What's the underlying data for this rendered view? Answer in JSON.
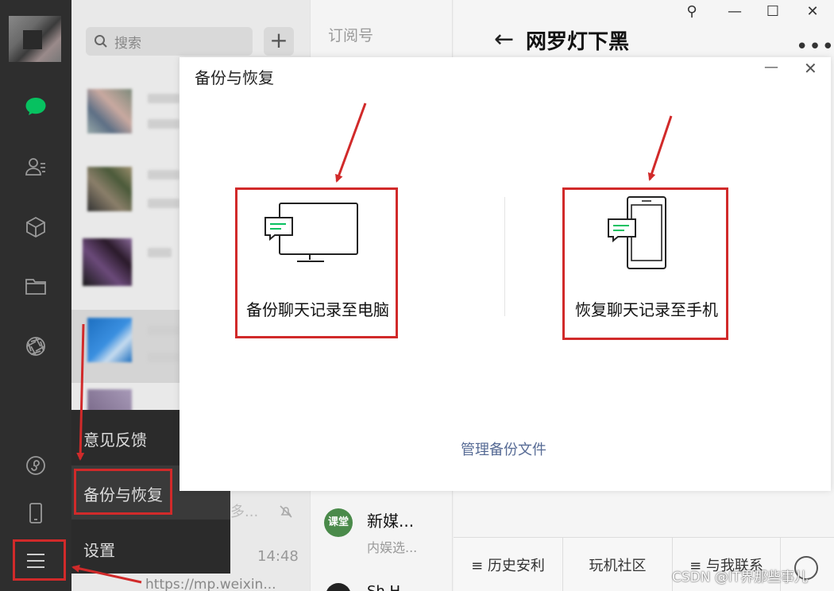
{
  "sidebar": {
    "icons": [
      "chat-icon",
      "contacts-icon",
      "favorites-icon",
      "files-icon",
      "moments-icon",
      "mini-program-icon",
      "phone-icon",
      "menu-icon"
    ]
  },
  "chat_list": {
    "search_placeholder": "搜索",
    "add_symbol": "+",
    "visible_time": "14:48",
    "fragment": "多...",
    "url_preview": "https://mp.weixin..."
  },
  "subscriptions": {
    "title": "订阅号",
    "account_logo_text": "课堂",
    "account_name": "新媒...",
    "account_desc": "内娱选...",
    "account2_name": "Sh H..."
  },
  "article": {
    "title": "网罗灯下黑",
    "back_symbol": "←",
    "more_symbol": "•••",
    "window_buttons": [
      "⚲",
      "—",
      "☐",
      "✕"
    ],
    "bottom_menu": [
      "≡ 历史安利",
      "玩机社区",
      "≡ 与我联系"
    ]
  },
  "popup_menu": {
    "items": [
      "意见反馈",
      "备份与恢复",
      "设置"
    ]
  },
  "dialog": {
    "title": "备份与恢复",
    "minimize": "—",
    "close": "✕",
    "option_backup": "备份聊天记录至电脑",
    "option_restore": "恢复聊天记录至手机",
    "manage_link": "管理备份文件"
  },
  "watermark": "CSDN @IT界那些事儿",
  "colors": {
    "annotation_red": "#d12a2a",
    "wechat_green": "#07c160",
    "link_blue": "#576b95"
  }
}
